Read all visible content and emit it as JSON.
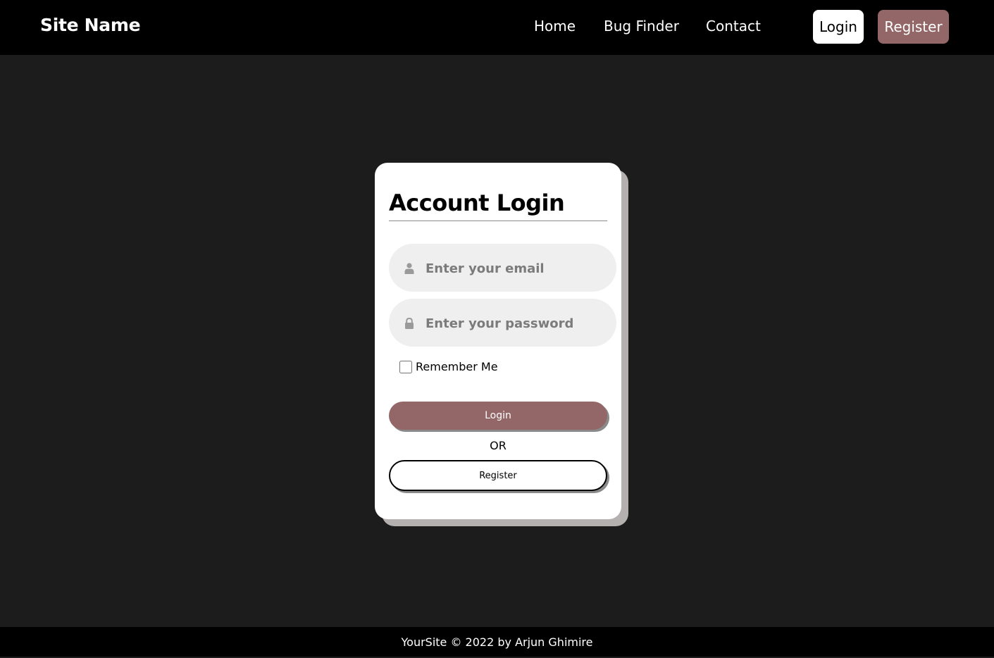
{
  "nav": {
    "site_name": "Site Name",
    "links": [
      "Home",
      "Bug Finder",
      "Contact"
    ],
    "login_label": "Login",
    "register_label": "Register"
  },
  "card": {
    "title": "Account Login",
    "email": {
      "icon": "user-icon",
      "placeholder": "Enter your email",
      "value": ""
    },
    "password": {
      "icon": "lock-icon",
      "placeholder": "Enter your password",
      "value": ""
    },
    "remember_label": "Remember Me",
    "remember_checked": false,
    "login_label": "Login",
    "or_text": "OR",
    "register_label": "Register"
  },
  "footer": {
    "text": "YourSite © 2022 by Arjun Ghimire"
  },
  "colors": {
    "accent": "#936667",
    "nav_bg": "#000000",
    "page_bg": "#1c1c1c",
    "card_bg": "#ffffff",
    "input_bg": "#efefef"
  }
}
